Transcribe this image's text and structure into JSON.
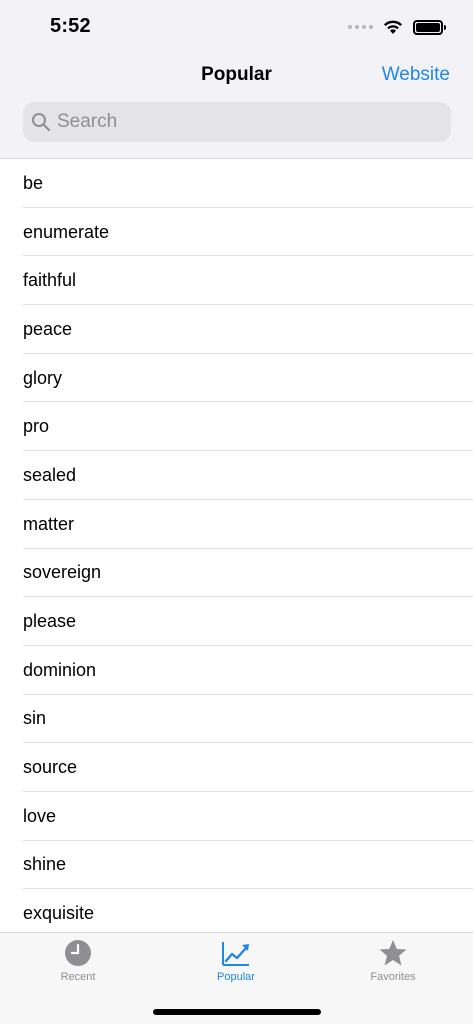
{
  "status_bar": {
    "time": "5:52"
  },
  "nav": {
    "title": "Popular",
    "action_label": "Website"
  },
  "search": {
    "placeholder": "Search",
    "value": ""
  },
  "list": {
    "items": [
      "be",
      "enumerate",
      "faithful",
      "peace",
      "glory",
      "pro",
      "sealed",
      "matter",
      "sovereign",
      "please",
      "dominion",
      "sin",
      "source",
      "love",
      "shine",
      "exquisite"
    ]
  },
  "tabs": [
    {
      "label": "Recent",
      "icon": "clock-icon",
      "active": false
    },
    {
      "label": "Popular",
      "icon": "trending-up-icon",
      "active": true
    },
    {
      "label": "Favorites",
      "icon": "star-icon",
      "active": false
    }
  ],
  "colors": {
    "accent": "#1e88e5",
    "inactive": "#8e8e93",
    "header_bg": "#f2f2f7"
  }
}
